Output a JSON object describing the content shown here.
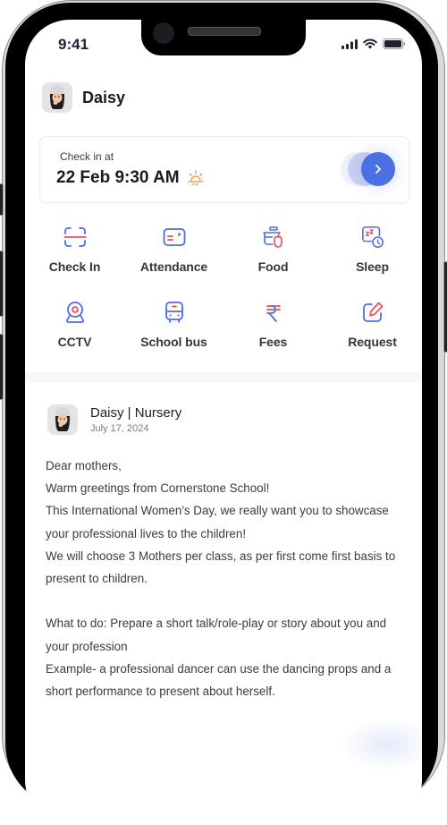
{
  "status_bar": {
    "time": "9:41",
    "icons": [
      "cellular-signal-icon",
      "wifi-icon",
      "battery-icon"
    ]
  },
  "header": {
    "avatar": "avatar-daisy",
    "name": "Daisy"
  },
  "checkin_card": {
    "label": "Check in at",
    "value": "22 Feb 9:30 AM",
    "icon": "sunrise-icon",
    "action_icon": "chevron-right-icon"
  },
  "quick_actions": [
    {
      "label": "Check In",
      "icon": "scan-icon"
    },
    {
      "label": "Attendance",
      "icon": "id-card-icon"
    },
    {
      "label": "Food",
      "icon": "lunchbox-icon"
    },
    {
      "label": "Sleep",
      "icon": "sleep-clock-icon"
    },
    {
      "label": "CCTV",
      "icon": "webcam-icon"
    },
    {
      "label": "School bus",
      "icon": "bus-icon"
    },
    {
      "label": "Fees",
      "icon": "rupee-icon"
    },
    {
      "label": "Request",
      "icon": "edit-icon"
    }
  ],
  "post": {
    "author": "Daisy | Nursery",
    "date": "July 17, 2024",
    "paragraphs": [
      "Dear mothers,",
      "Warm greetings from Cornerstone School!",
      "This International Women's Day, we really want you to showcase your professional lives to the children!",
      "We will choose 3 Mothers per class, as per first come first basis to present to children.",
      "",
      "What to do: Prepare a short talk/role-play or story about you and your profession",
      "Example- a professional dancer can use the dancing props and a short performance to present about herself."
    ]
  },
  "colors": {
    "accent_blue": "#4a70e2",
    "accent_red": "#f04b5b",
    "sun_orange": "#f5a05a"
  }
}
